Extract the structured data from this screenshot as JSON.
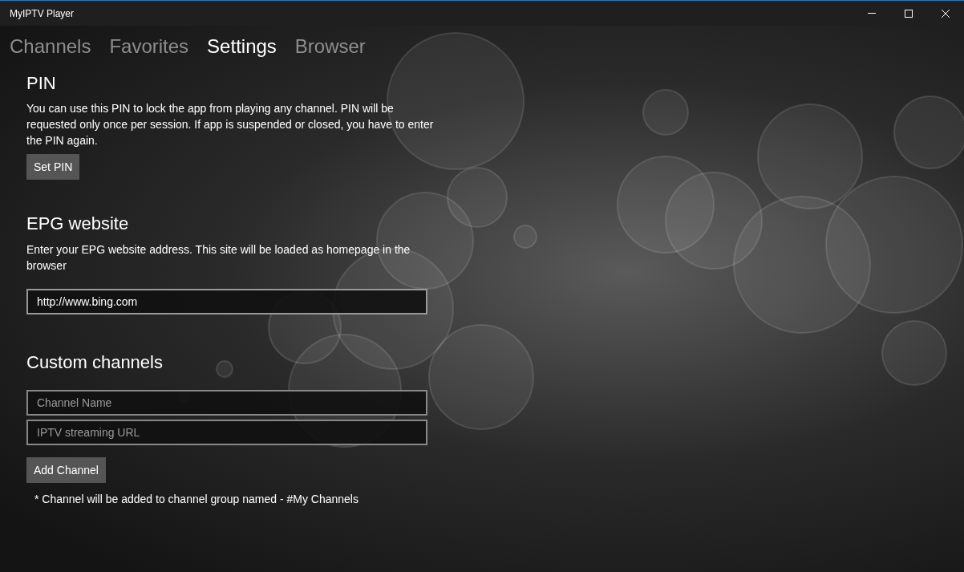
{
  "window": {
    "title": "MyIPTV Player"
  },
  "tabs": [
    {
      "label": "Channels",
      "selected": false
    },
    {
      "label": "Favorites",
      "selected": false
    },
    {
      "label": "Settings",
      "selected": true
    },
    {
      "label": "Browser",
      "selected": false
    }
  ],
  "pin": {
    "heading": "PIN",
    "description": "You can use this PIN to lock the app from playing any channel. PIN will be requested only once per session. If app is suspended or closed, you have to enter the PIN again.",
    "button": "Set PIN"
  },
  "epg": {
    "heading": "EPG website",
    "description": "Enter your EPG website address. This site will be loaded as homepage in the browser",
    "field": {
      "value": "http://www.bing.com"
    }
  },
  "custom_channels": {
    "heading": "Custom channels",
    "fields": [
      {
        "placeholder": "Channel Name"
      },
      {
        "placeholder": "IPTV streaming URL"
      }
    ],
    "button": "Add Channel",
    "note": "* Channel will be added to channel group named - #My Channels"
  }
}
